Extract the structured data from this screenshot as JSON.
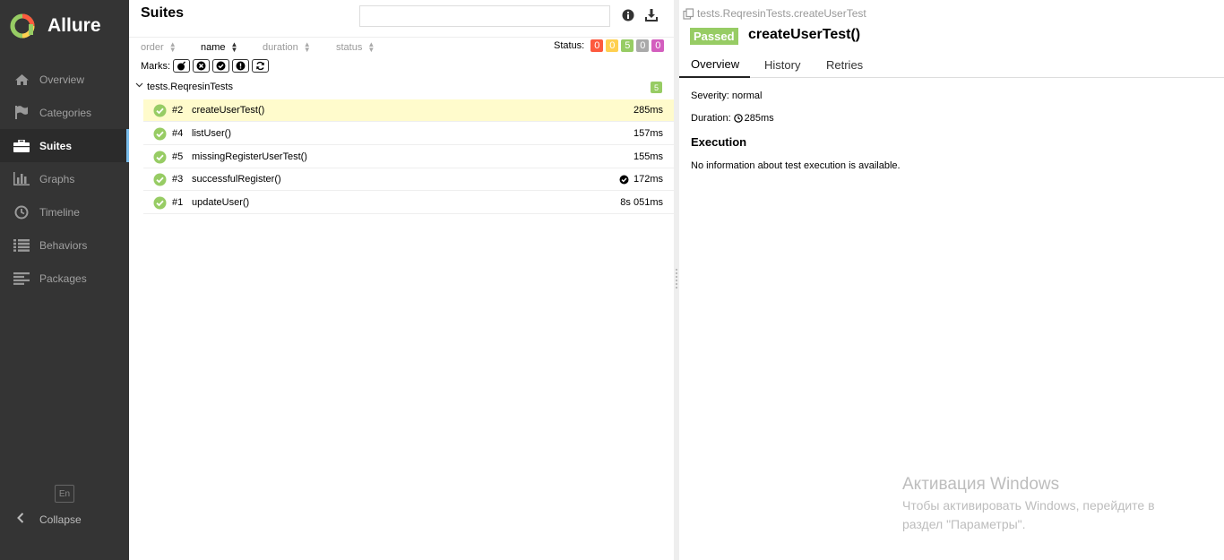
{
  "app": {
    "brand": "Allure"
  },
  "sidebar": {
    "items": [
      {
        "label": "Overview",
        "icon": "home-icon"
      },
      {
        "label": "Categories",
        "icon": "flag-icon"
      },
      {
        "label": "Suites",
        "icon": "briefcase-icon",
        "active": true
      },
      {
        "label": "Graphs",
        "icon": "bar-chart-icon"
      },
      {
        "label": "Timeline",
        "icon": "clock-icon"
      },
      {
        "label": "Behaviors",
        "icon": "list-icon"
      },
      {
        "label": "Packages",
        "icon": "align-left-icon"
      }
    ],
    "language": "En",
    "collapse_label": "Collapse"
  },
  "suites": {
    "title": "Suites",
    "search": {
      "value": "",
      "placeholder": ""
    },
    "sorters": [
      {
        "label": "order"
      },
      {
        "label": "name",
        "active": true
      },
      {
        "label": "duration"
      },
      {
        "label": "status"
      }
    ],
    "status_label": "Status:",
    "status_counts": [
      {
        "value": "0",
        "color": "#fd5a3e"
      },
      {
        "value": "0",
        "color": "#ffd050"
      },
      {
        "value": "5",
        "color": "#97cc64"
      },
      {
        "value": "0",
        "color": "#aaaaaa"
      },
      {
        "value": "0",
        "color": "#d35ebe"
      }
    ],
    "marks_label": "Marks:",
    "group": {
      "name": "tests.ReqresinTests",
      "count": "5"
    },
    "rows": [
      {
        "num": "#2",
        "name": "createUserTest()",
        "duration": "285ms",
        "selected": true
      },
      {
        "num": "#4",
        "name": "listUser()",
        "duration": "157ms"
      },
      {
        "num": "#5",
        "name": "missingRegisterUserTest()",
        "duration": "155ms"
      },
      {
        "num": "#3",
        "name": "successfulRegister()",
        "duration": "172ms",
        "mark": "check-circle-icon"
      },
      {
        "num": "#1",
        "name": "updateUser()",
        "duration": "8s 051ms"
      }
    ]
  },
  "details": {
    "breadcrumb": "tests.ReqresinTests.createUserTest",
    "status": "Passed",
    "title": "createUserTest()",
    "tabs": [
      "Overview",
      "History",
      "Retries"
    ],
    "severity": "Severity: normal",
    "duration_label": "Duration:",
    "duration_value": "285ms",
    "execution_title": "Execution",
    "execution_info": "No information about test execution is available."
  },
  "watermark": {
    "title": "Активация Windows",
    "line1": "Чтобы активировать Windows, перейдите в",
    "line2": "раздел \"Параметры\"."
  }
}
